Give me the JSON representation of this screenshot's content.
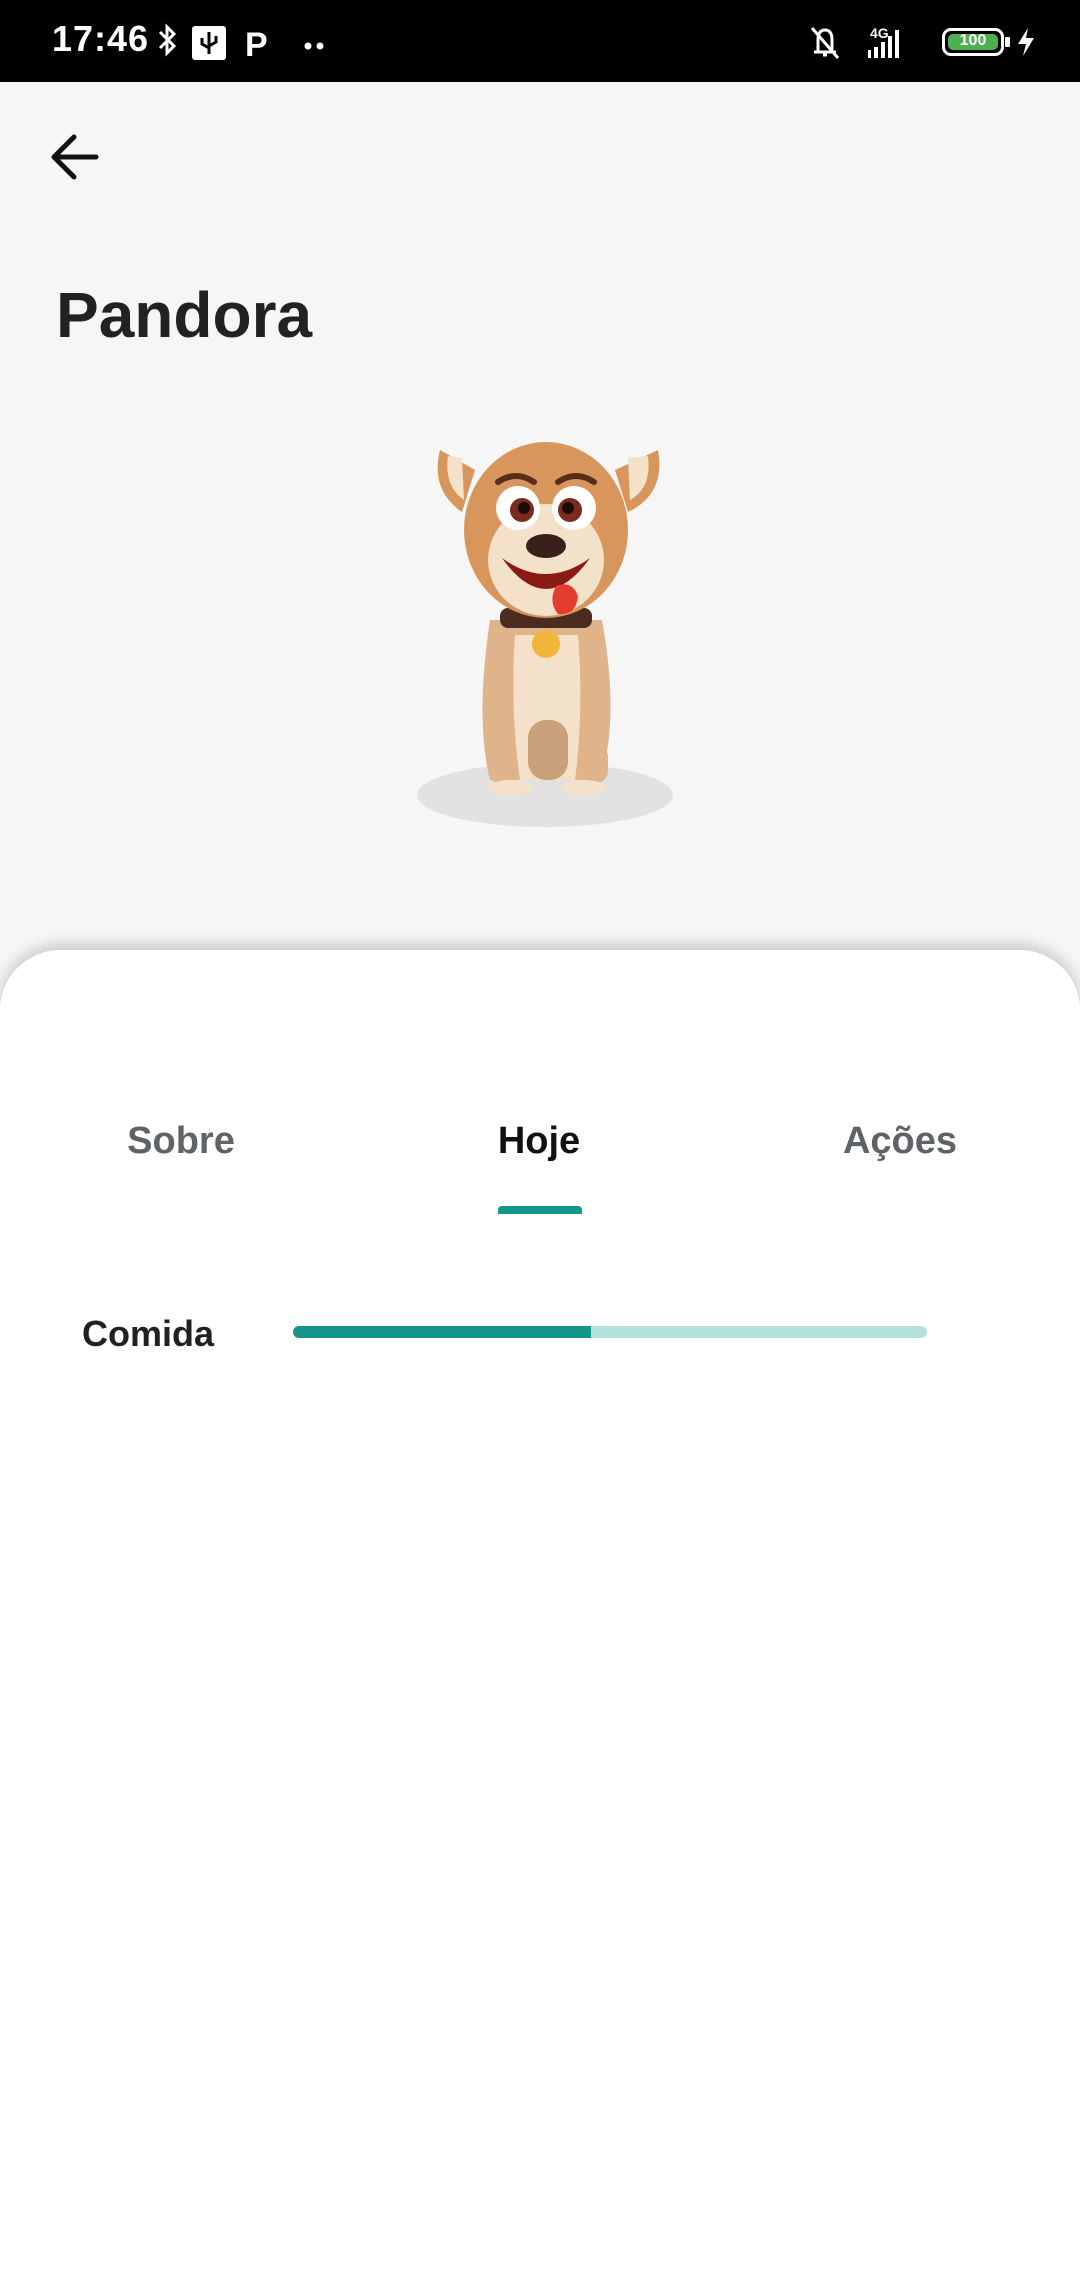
{
  "status_bar": {
    "time": "17:46",
    "left_icons": [
      "bluetooth-icon",
      "usb-icon",
      "parking-app-icon",
      "more-dots-icon"
    ],
    "right_icons": [
      "muted-bell-icon",
      "4g-signal-icon",
      "battery-icon",
      "charging-icon"
    ],
    "network": "4G",
    "battery_level": "100"
  },
  "header": {
    "back_icon": "arrow-left-icon",
    "title": "Pandora"
  },
  "pet": {
    "image_icon": "dog-cartoon-image"
  },
  "tabs": [
    {
      "label": "Sobre",
      "active": false
    },
    {
      "label": "Hoje",
      "active": true
    },
    {
      "label": "Ações",
      "active": false
    }
  ],
  "stats": [
    {
      "label": "Comida",
      "progress": 0.47
    }
  ],
  "colors": {
    "accent": "#14978a",
    "accent_light": "#b2e0db",
    "battery_green": "#4caf50"
  }
}
